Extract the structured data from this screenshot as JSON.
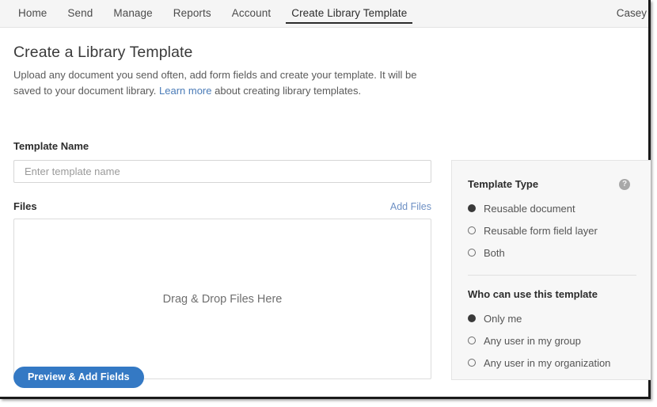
{
  "nav": {
    "items": [
      {
        "label": "Home",
        "active": false
      },
      {
        "label": "Send",
        "active": false
      },
      {
        "label": "Manage",
        "active": false
      },
      {
        "label": "Reports",
        "active": false
      },
      {
        "label": "Account",
        "active": false
      },
      {
        "label": "Create Library Template",
        "active": true
      }
    ],
    "user": "Casey"
  },
  "page": {
    "title": "Create a Library Template",
    "subtitle_part1": "Upload any document you send often, add form fields and create your template. It will be saved to your document library. ",
    "subtitle_link": "Learn more",
    "subtitle_part2": " about creating library templates."
  },
  "form": {
    "template_name_label": "Template Name",
    "template_name_value": "",
    "template_name_placeholder": "Enter template name",
    "files_label": "Files",
    "add_files_label": "Add Files",
    "drop_zone_text": "Drag & Drop Files Here",
    "submit_label": "Preview & Add Fields"
  },
  "options": {
    "template_type": {
      "heading": "Template Type",
      "help_icon": "question-mark-icon",
      "help_glyph": "?",
      "choices": [
        {
          "label": "Reusable document",
          "selected": true
        },
        {
          "label": "Reusable form field layer",
          "selected": false
        },
        {
          "label": "Both",
          "selected": false
        }
      ]
    },
    "who_can_use": {
      "heading": "Who can use this template",
      "choices": [
        {
          "label": "Only me",
          "selected": true
        },
        {
          "label": "Any user in my group",
          "selected": false
        },
        {
          "label": "Any user in my organization",
          "selected": false
        }
      ]
    }
  },
  "colors": {
    "accent_button": "#3479c4",
    "link": "#4a7bb7",
    "panel_bg": "#f7f7f7",
    "nav_bg": "#f5f5f5"
  }
}
